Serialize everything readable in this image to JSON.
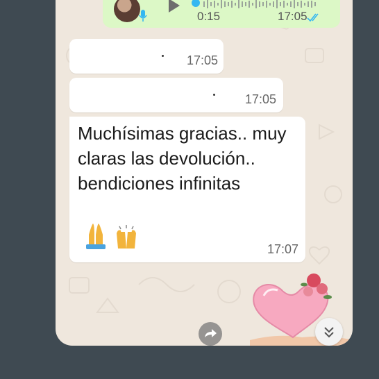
{
  "voice_message": {
    "duration": "0:15",
    "time": "17:05",
    "status": "read",
    "tick_color": "#34b7f1"
  },
  "messages": [
    {
      "text": "·",
      "time": "17:05"
    },
    {
      "text": "·",
      "time": "17:05"
    },
    {
      "text": "Muchísimas gracias.. muy claras las devolución.. bendiciones infinitas",
      "emojis": [
        "folded-hands",
        "raising-hands"
      ],
      "time": "17:07"
    }
  ],
  "icons": {
    "forward": "forward-arrow-icon",
    "scroll_down": "double-chevron-down-icon",
    "mic": "microphone-icon",
    "play": "play-icon"
  },
  "colors": {
    "chat_background": "#efe7dd",
    "outgoing_bubble": "#dcf8c6",
    "incoming_bubble": "#ffffff"
  }
}
